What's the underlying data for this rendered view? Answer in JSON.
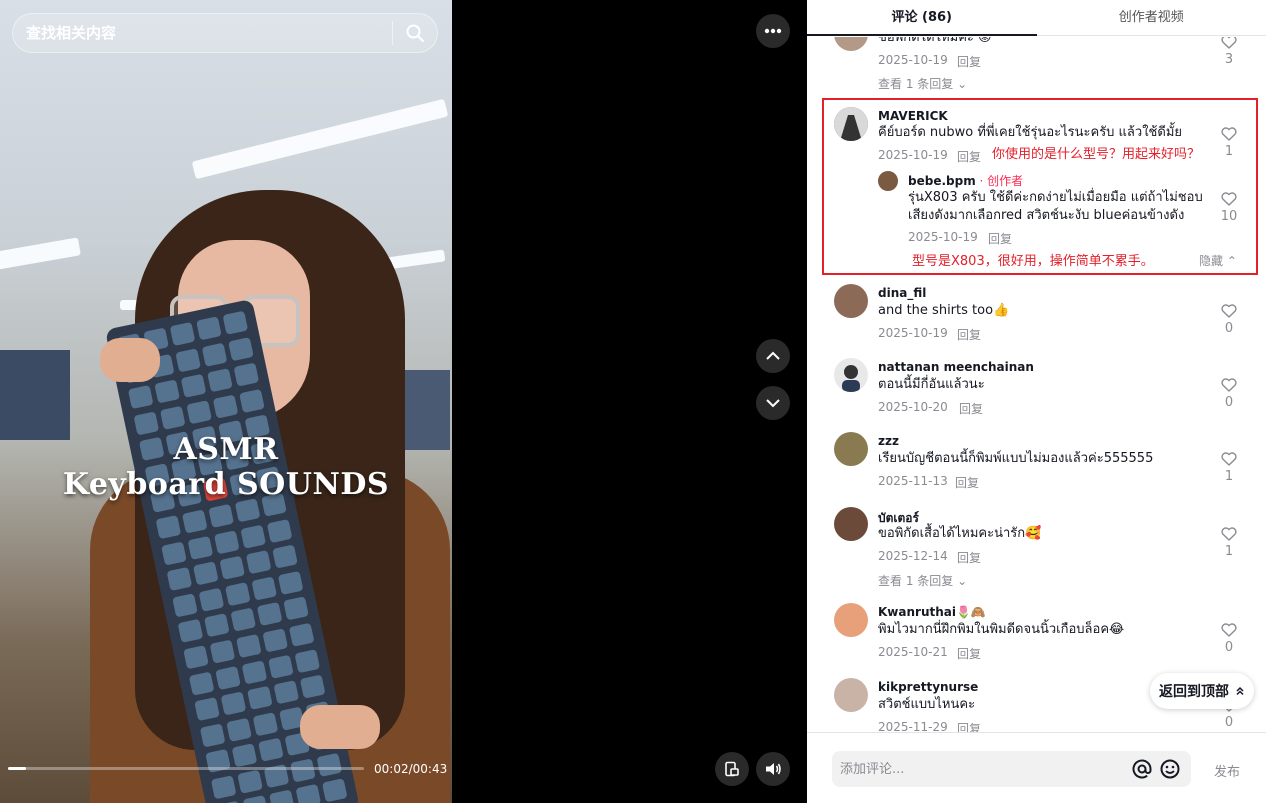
{
  "search": {
    "placeholder": "查找相关内容"
  },
  "video": {
    "overlay_line1": "ASMR",
    "overlay_line2": "Keyboard SOUNDS",
    "time": "00:02/00:43",
    "progress_fraction": 0.05
  },
  "tabs": [
    {
      "label": "评论 (86)",
      "active": true
    },
    {
      "label": "创作者视频",
      "active": false
    }
  ],
  "comments": [
    {
      "id": "c0",
      "partial_text": "ขอพิกัดได้ไหมคะ 😟",
      "date": "2025-10-19",
      "reply": "回复",
      "likes": "3",
      "more_replies": "查看 1 条回复"
    },
    {
      "id": "c1",
      "name": "MAVERICK",
      "text": "คีย์บอร์ด nubwo ที่พี่เคยใช้รุ่นอะไรนะครับ แล้วใช้ดีมั้ย",
      "date": "2025-10-19",
      "reply": "回复",
      "likes": "1",
      "annotation": "你使用的是什么型号？用起来好吗？",
      "sub": {
        "name": "bebe.bpm",
        "creator_tag": " · 创作者",
        "text": "รุ่นX803 ครับ ใช้ดีค่ะกดง่ายไม่เมื่อยมือ แต่ถ้าไม่ชอบเสียงดังมากเลือกred สวิตช์นะงับ blueค่อนข้างดัง",
        "date": "2025-10-19",
        "reply": "回复",
        "likes": "10",
        "annotation": "型号是X803，很好用，操作简单不累手。",
        "hide": "隐藏"
      }
    },
    {
      "id": "c2",
      "name": "dina_fil",
      "text": "and the shirts too👍",
      "date": "2025-10-19",
      "reply": "回复",
      "likes": "0"
    },
    {
      "id": "c3",
      "name": "nattanan meenchainan",
      "text": "ตอนนี้มีกี่อันแล้วนะ",
      "date": "2025-10-20",
      "reply": "回复",
      "likes": "0"
    },
    {
      "id": "c4",
      "name": "zzz",
      "text": "เรียนบัญชีตอนนี้ก็พิมพ์แบบไม่มองแล้วค่ะ555555",
      "date": "2025-11-13",
      "reply": "回复",
      "likes": "1"
    },
    {
      "id": "c5",
      "name": "บัตเตอร์",
      "text": "ขอพิกัดเสื้อได้ไหมคะน่ารัก🥰",
      "date": "2025-12-14",
      "reply": "回复",
      "likes": "1",
      "more_replies": "查看 1 条回复"
    },
    {
      "id": "c6",
      "name": "Kwanruthai🌷🙈",
      "text": "พิมไวมากนี่ฝึกพิมในพิมดีดจนนิ้วเกือบล็อค😂",
      "date": "2025-10-21",
      "reply": "回复",
      "likes": "0"
    },
    {
      "id": "c7",
      "name": "kikprettynurse",
      "text": "สวิตช์แบบไหนคะ",
      "date": "2025-11-29",
      "reply": "回复",
      "likes": "0"
    }
  ],
  "back_to_top": "返回到顶部",
  "composer": {
    "placeholder": "添加评论...",
    "publish": "发布"
  },
  "colors": {
    "creator": "#fe2c55",
    "annotation": "#e4202b"
  }
}
